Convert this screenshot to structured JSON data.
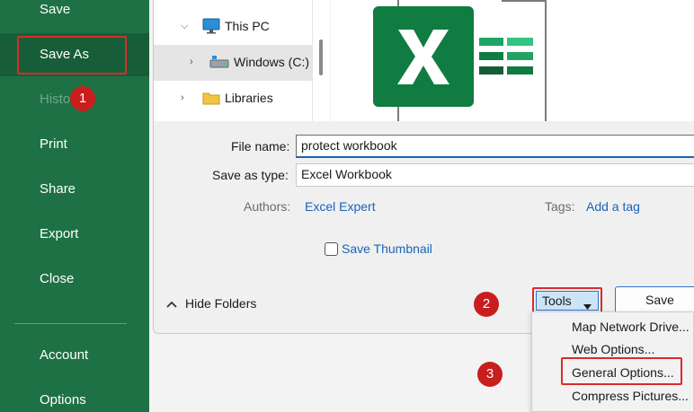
{
  "sidebar": {
    "items": [
      {
        "label": "Save"
      },
      {
        "label": "Save As"
      },
      {
        "label": "History"
      },
      {
        "label": "Print"
      },
      {
        "label": "Share"
      },
      {
        "label": "Export"
      },
      {
        "label": "Close"
      },
      {
        "label": "Account"
      },
      {
        "label": "Options"
      }
    ]
  },
  "nav_tree": {
    "items": [
      {
        "label": "This PC",
        "icon": "monitor-icon"
      },
      {
        "label": "Windows (C:)",
        "icon": "drive-icon"
      },
      {
        "label": "Libraries",
        "icon": "folder-icon"
      }
    ]
  },
  "form": {
    "file_name_label": "File name:",
    "file_name_value": "protect workbook",
    "save_type_label": "Save as type:",
    "save_type_value": "Excel Workbook",
    "authors_label": "Authors:",
    "authors_value": "Excel Expert",
    "tags_label": "Tags:",
    "tags_value": "Add a tag",
    "thumbnail_label": "Save Thumbnail"
  },
  "footer": {
    "hide_folders_label": "Hide Folders",
    "tools_label": "Tools",
    "save_label": "Save"
  },
  "tools_menu": {
    "items": [
      {
        "label": "Map Network Drive..."
      },
      {
        "label": "Web Options..."
      },
      {
        "label": "General Options..."
      },
      {
        "label": "Compress Pictures..."
      }
    ]
  },
  "badges": [
    "1",
    "2",
    "3"
  ],
  "colors": {
    "sidebar_bg": "#1e7145",
    "highlight_red": "#d92b2b",
    "excel_green": "#107c41",
    "link_blue": "#1c63b7"
  }
}
